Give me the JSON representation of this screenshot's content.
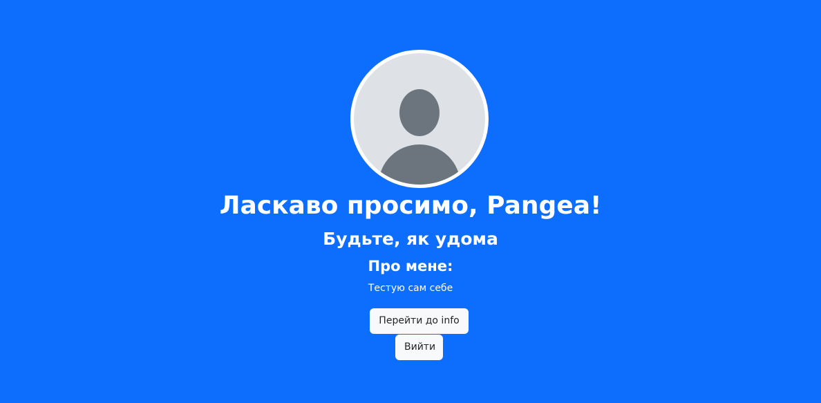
{
  "profile": {
    "welcome": "Ласкаво просимо, Pangea!",
    "subtitle": "Будьте, як удома",
    "about_title": "Про мене:",
    "about_text": "Тестую сам себе"
  },
  "actions": {
    "go_info_label": "Перейти до info",
    "logout_label": "Вийти"
  },
  "colors": {
    "background": "#0d6efd",
    "avatar_background": "#dee2e6",
    "avatar_figure": "#6c757d",
    "button_background": "#f8f9fa"
  },
  "icons": {
    "avatar": "default-user-avatar"
  }
}
